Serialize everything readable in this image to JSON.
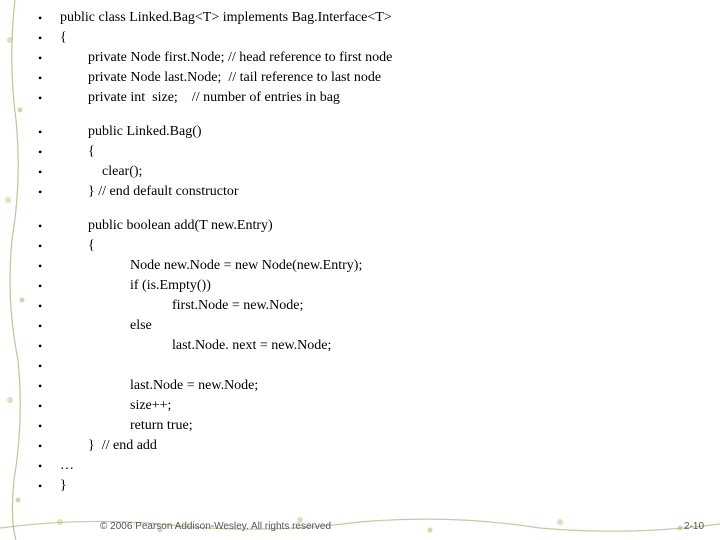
{
  "code": {
    "block1": [
      "public class Linked.Bag<T> implements Bag.Interface<T>",
      "{",
      "        private Node first.Node; // head reference to first node",
      "        private Node last.Node;  // tail reference to last node",
      "        private int  size;    // number of entries in bag"
    ],
    "block2": [
      "        public Linked.Bag()",
      "        {",
      "            clear();",
      "        } // end default constructor"
    ],
    "block3": [
      "        public boolean add(T new.Entry)",
      "        {",
      "                    Node new.Node = new Node(new.Entry);",
      "                    if (is.Empty())",
      "                                first.Node = new.Node;",
      "                    else",
      "                                last.Node. next = new.Node;",
      "",
      "                    last.Node = new.Node;",
      "                    size++;",
      "                    return true;",
      "        }  // end add",
      "…",
      "}"
    ]
  },
  "footer": {
    "copyright": "© 2006 Pearson Addison-Wesley. All rights reserved",
    "page": "2-10"
  }
}
